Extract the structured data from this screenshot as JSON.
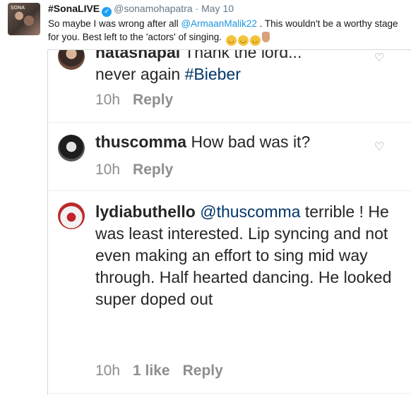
{
  "tweet": {
    "display_name": "#SonaLIVE",
    "handle": "@sonamohapatra",
    "separator": "·",
    "date": "May 10",
    "text_before_mention": "So maybe I was wrong after all ",
    "mention": "@ArmaanMalik22",
    "text_after_mention": " . This wouldn't be a worthy stage for you. Best left to the 'actors' of singing. ",
    "avatar_label": "SONA"
  },
  "comments": [
    {
      "username": "natashapai",
      "text": "Thank the lord...",
      "line2": "never again ",
      "hashtag": "#Bieber",
      "time": "10h",
      "reply": "Reply"
    },
    {
      "username": "thuscomma",
      "text": "How bad was it?",
      "time": "10h",
      "reply": "Reply"
    },
    {
      "username": "lydiabuthello",
      "mention": "@thuscomma",
      "text": "terrible ! He was least interested. Lip syncing and not even making an effort to sing mid way through. Half hearted dancing. He looked super doped out",
      "time": "10h",
      "likes": "1 like",
      "reply": "Reply"
    }
  ]
}
